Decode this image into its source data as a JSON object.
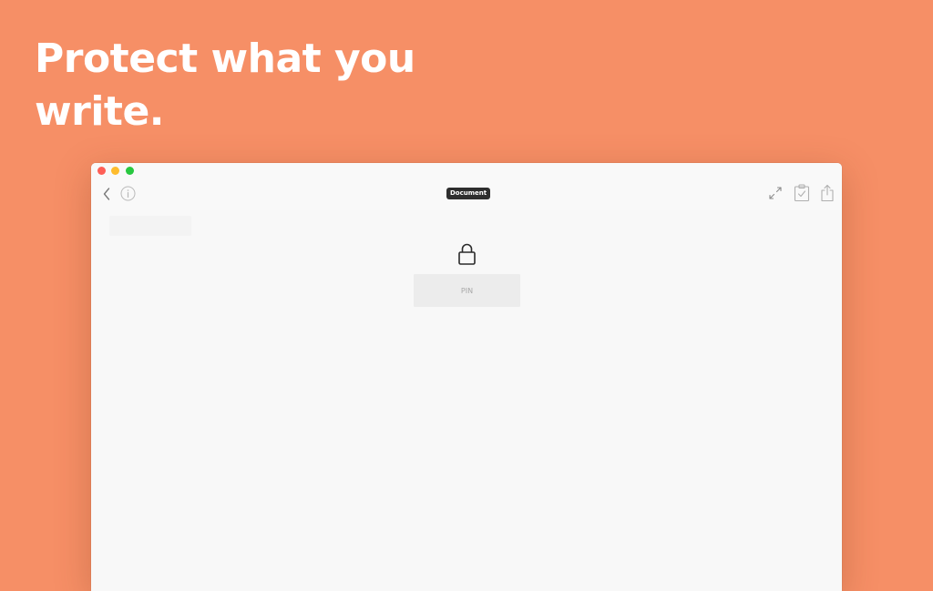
{
  "headline": {
    "text": "Protect what you write."
  },
  "window": {
    "document_tag": "Document",
    "pin_input": {
      "placeholder": "PIN",
      "value": ""
    },
    "icons": {
      "back": "chevron-left-icon",
      "info": "info-icon",
      "expand": "expand-icon",
      "clipboard": "clipboard-check-icon",
      "share": "share-icon",
      "lock": "lock-icon"
    }
  },
  "colors": {
    "background": "#f68f66",
    "window": "#f8f8f8",
    "headline_text": "#ffffff",
    "tag_background": "#2e2e2e",
    "traffic_close": "#fe5f57",
    "traffic_minimize": "#febc2e",
    "traffic_zoom": "#28c840"
  }
}
